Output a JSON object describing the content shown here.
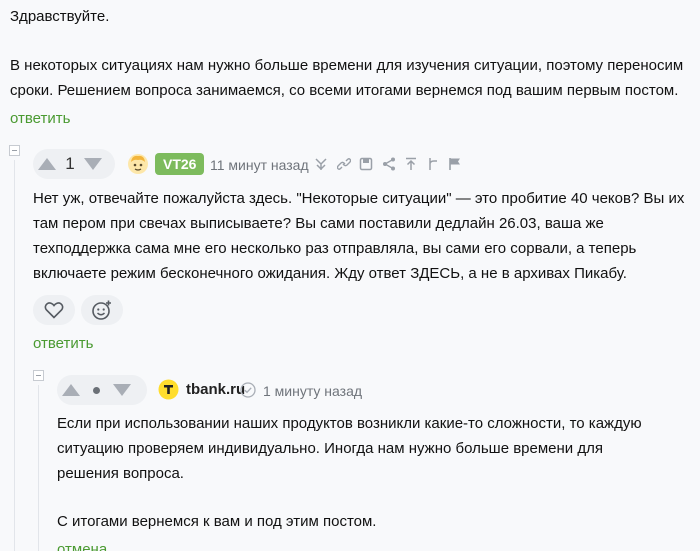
{
  "first_comment": {
    "greeting": "Здравствуйте.",
    "line1": "В некоторых ситуациях нам нужно больше времени для изучения ситуации, поэтому переносим",
    "line2": "сроки. Решением вопроса занимаемся, со всеми итогами вернемся под вашим первым постом.",
    "reply_label": "ответить"
  },
  "vt26_comment": {
    "rating": "1",
    "username": "VT26",
    "time": "11 минут назад",
    "lines": [
      "Нет уж, отвечайте пожалуйста здесь. \"Некоторые ситуации\" — это пробитие 40 чеков? Вы их",
      "там пером при свечах выписываете? Вы сами поставили дедлайн 26.03, ваша же",
      "техподдержка сама мне его несколько раз отправляла, вы сами его сорвали, а теперь",
      "включаете режим бесконечного ожидания. Жду ответ ЗДЕСЬ, а не в архивах Пикабу."
    ],
    "reply_label": "ответить",
    "badge_color": "#7dbb5d"
  },
  "tbank_comment": {
    "username": "tbank.ru",
    "time": "1 минуту назад",
    "lines": [
      "Если при использовании наших продуктов возникли какие-то сложности, то каждую",
      "ситуацию проверяем индивидуально. Иногда нам нужно больше времени для",
      "решения вопроса."
    ],
    "closing": "С итогами вернемся к вам и под этим постом.",
    "cancel_label": "отмена",
    "logo_color": "#ffdd2d"
  },
  "accent_color": "#4a9a31"
}
